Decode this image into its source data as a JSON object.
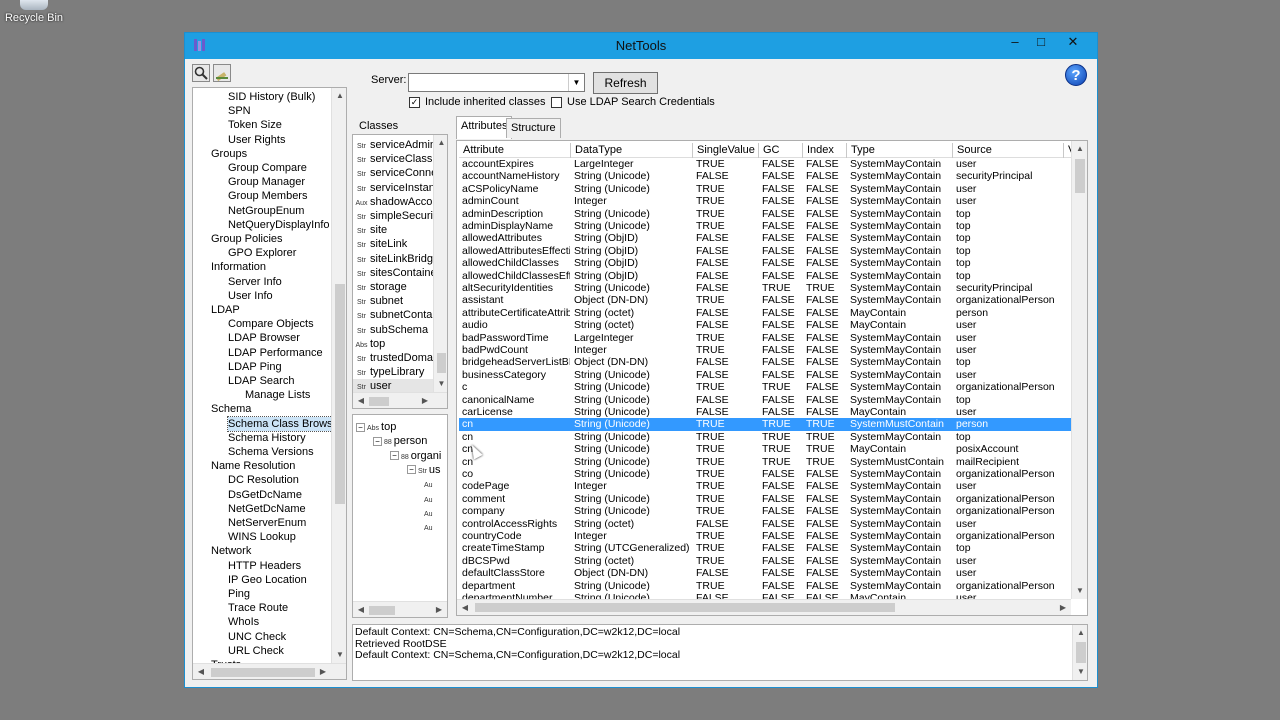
{
  "desktop": {
    "recycle_bin_label": "Recycle Bin"
  },
  "window": {
    "title": "NetTools",
    "min_glyph": "–",
    "max_glyph": "□",
    "close_glyph": "✕"
  },
  "toolbar": {
    "search_icon": "search-icon",
    "edit_icon": "edit-icon"
  },
  "nav_tree": {
    "items": [
      {
        "label": "SID History (Bulk)",
        "indent": 2
      },
      {
        "label": "SPN",
        "indent": 2
      },
      {
        "label": "Token Size",
        "indent": 2
      },
      {
        "label": "User Rights",
        "indent": 2
      },
      {
        "label": "Groups",
        "indent": 1
      },
      {
        "label": "Group Compare",
        "indent": 2
      },
      {
        "label": "Group Manager",
        "indent": 2
      },
      {
        "label": "Group Members",
        "indent": 2
      },
      {
        "label": "NetGroupEnum",
        "indent": 2
      },
      {
        "label": "NetQueryDisplayInfo",
        "indent": 2
      },
      {
        "label": "Group Policies",
        "indent": 1
      },
      {
        "label": "GPO Explorer",
        "indent": 2
      },
      {
        "label": "Information",
        "indent": 1
      },
      {
        "label": "Server Info",
        "indent": 2
      },
      {
        "label": "User Info",
        "indent": 2
      },
      {
        "label": "LDAP",
        "indent": 1
      },
      {
        "label": "Compare Objects",
        "indent": 2
      },
      {
        "label": "LDAP Browser",
        "indent": 2
      },
      {
        "label": "LDAP Performance",
        "indent": 2
      },
      {
        "label": "LDAP Ping",
        "indent": 2
      },
      {
        "label": "LDAP Search",
        "indent": 2
      },
      {
        "label": "Manage Lists",
        "indent": 3
      },
      {
        "label": "Schema",
        "indent": 1
      },
      {
        "label": "Schema Class Browser",
        "indent": 2,
        "selected": true
      },
      {
        "label": "Schema History",
        "indent": 2
      },
      {
        "label": "Schema Versions",
        "indent": 2
      },
      {
        "label": "Name Resolution",
        "indent": 1
      },
      {
        "label": "DC Resolution",
        "indent": 2
      },
      {
        "label": "DsGetDcName",
        "indent": 2
      },
      {
        "label": "NetGetDcName",
        "indent": 2
      },
      {
        "label": "NetServerEnum",
        "indent": 2
      },
      {
        "label": "WINS Lookup",
        "indent": 2
      },
      {
        "label": "Network",
        "indent": 1
      },
      {
        "label": "HTTP Headers",
        "indent": 2
      },
      {
        "label": "IP Geo Location",
        "indent": 2
      },
      {
        "label": "Ping",
        "indent": 2
      },
      {
        "label": "Trace Route",
        "indent": 2
      },
      {
        "label": "WhoIs",
        "indent": 2
      },
      {
        "label": "UNC Check",
        "indent": 2
      },
      {
        "label": "URL Check",
        "indent": 2
      },
      {
        "label": "Trusts",
        "indent": 1
      }
    ]
  },
  "server": {
    "label": "Server:",
    "value": "",
    "refresh_label": "Refresh"
  },
  "options": {
    "include_inherited": {
      "label": "Include inherited classes",
      "checked": true
    },
    "ldap_credentials": {
      "label": "Use LDAP Search Credentials",
      "checked": false
    }
  },
  "classes": {
    "label": "Classes",
    "items": [
      {
        "type": "Str",
        "name": "serviceAdminis"
      },
      {
        "type": "Str",
        "name": "serviceClass"
      },
      {
        "type": "Str",
        "name": "serviceConnec"
      },
      {
        "type": "Str",
        "name": "serviceInstanc"
      },
      {
        "type": "Aux",
        "name": "shadowAccou"
      },
      {
        "type": "Str",
        "name": "simpleSecurityI"
      },
      {
        "type": "Str",
        "name": "site"
      },
      {
        "type": "Str",
        "name": "siteLink"
      },
      {
        "type": "Str",
        "name": "siteLinkBridge"
      },
      {
        "type": "Str",
        "name": "sitesContainer"
      },
      {
        "type": "Str",
        "name": "storage"
      },
      {
        "type": "Str",
        "name": "subnet"
      },
      {
        "type": "Str",
        "name": "subnetContain"
      },
      {
        "type": "Str",
        "name": "subSchema"
      },
      {
        "type": "Abs",
        "name": "top"
      },
      {
        "type": "Str",
        "name": "trustedDomain"
      },
      {
        "type": "Str",
        "name": "typeLibrary"
      },
      {
        "type": "Str",
        "name": "user",
        "selected": true
      }
    ]
  },
  "structure_tree": {
    "items": [
      {
        "type": "Abs",
        "name": "top",
        "level": 0,
        "toggle": "−"
      },
      {
        "type": "88",
        "name": "person",
        "level": 1,
        "toggle": "−"
      },
      {
        "type": "88",
        "name": "organi",
        "level": 2,
        "toggle": "−"
      },
      {
        "type": "Str",
        "name": "us",
        "level": 3,
        "toggle": "−"
      },
      {
        "type": "Au",
        "name": "",
        "level": 4
      },
      {
        "type": "Au",
        "name": "",
        "level": 4
      },
      {
        "type": "Au",
        "name": "",
        "level": 4
      },
      {
        "type": "Au",
        "name": "",
        "level": 4
      }
    ]
  },
  "tabs": [
    {
      "label": "Attributes",
      "active": true
    },
    {
      "label": "Structure",
      "active": false
    }
  ],
  "attributes": {
    "columns": [
      "Attribute",
      "DataType",
      "SingleValue",
      "GC",
      "Index",
      "Type",
      "Source",
      "V"
    ],
    "rows": [
      [
        "accountExpires",
        "LargeInteger",
        "TRUE",
        "FALSE",
        "FALSE",
        "SystemMayContain",
        "user"
      ],
      [
        "accountNameHistory",
        "String (Unicode)",
        "FALSE",
        "FALSE",
        "FALSE",
        "SystemMayContain",
        "securityPrincipal"
      ],
      [
        "aCSPolicyName",
        "String (Unicode)",
        "TRUE",
        "FALSE",
        "FALSE",
        "SystemMayContain",
        "user"
      ],
      [
        "adminCount",
        "Integer",
        "TRUE",
        "FALSE",
        "FALSE",
        "SystemMayContain",
        "user"
      ],
      [
        "adminDescription",
        "String (Unicode)",
        "TRUE",
        "FALSE",
        "FALSE",
        "SystemMayContain",
        "top"
      ],
      [
        "adminDisplayName",
        "String (Unicode)",
        "TRUE",
        "FALSE",
        "FALSE",
        "SystemMayContain",
        "top"
      ],
      [
        "allowedAttributes",
        "String (ObjID)",
        "FALSE",
        "FALSE",
        "FALSE",
        "SystemMayContain",
        "top"
      ],
      [
        "allowedAttributesEffecti...",
        "String (ObjID)",
        "FALSE",
        "FALSE",
        "FALSE",
        "SystemMayContain",
        "top"
      ],
      [
        "allowedChildClasses",
        "String (ObjID)",
        "FALSE",
        "FALSE",
        "FALSE",
        "SystemMayContain",
        "top"
      ],
      [
        "allowedChildClassesEff...",
        "String (ObjID)",
        "FALSE",
        "FALSE",
        "FALSE",
        "SystemMayContain",
        "top"
      ],
      [
        "altSecurityIdentities",
        "String (Unicode)",
        "FALSE",
        "TRUE",
        "TRUE",
        "SystemMayContain",
        "securityPrincipal"
      ],
      [
        "assistant",
        "Object (DN-DN)",
        "TRUE",
        "FALSE",
        "FALSE",
        "SystemMayContain",
        "organizationalPerson"
      ],
      [
        "attributeCertificateAttrib...",
        "String (octet)",
        "FALSE",
        "FALSE",
        "FALSE",
        "MayContain",
        "person"
      ],
      [
        "audio",
        "String (octet)",
        "FALSE",
        "FALSE",
        "FALSE",
        "MayContain",
        "user"
      ],
      [
        "badPasswordTime",
        "LargeInteger",
        "TRUE",
        "FALSE",
        "FALSE",
        "SystemMayContain",
        "user"
      ],
      [
        "badPwdCount",
        "Integer",
        "TRUE",
        "FALSE",
        "FALSE",
        "SystemMayContain",
        "user"
      ],
      [
        "bridgeheadServerListBL",
        "Object (DN-DN)",
        "FALSE",
        "FALSE",
        "FALSE",
        "SystemMayContain",
        "top"
      ],
      [
        "businessCategory",
        "String (Unicode)",
        "FALSE",
        "FALSE",
        "FALSE",
        "SystemMayContain",
        "user"
      ],
      [
        "c",
        "String (Unicode)",
        "TRUE",
        "TRUE",
        "FALSE",
        "SystemMayContain",
        "organizationalPerson"
      ],
      [
        "canonicalName",
        "String (Unicode)",
        "FALSE",
        "FALSE",
        "FALSE",
        "SystemMayContain",
        "top"
      ],
      [
        "carLicense",
        "String (Unicode)",
        "FALSE",
        "FALSE",
        "FALSE",
        "MayContain",
        "user"
      ],
      [
        "cn",
        "String (Unicode)",
        "TRUE",
        "TRUE",
        "TRUE",
        "SystemMustContain",
        "person",
        true
      ],
      [
        "cn",
        "String (Unicode)",
        "TRUE",
        "TRUE",
        "TRUE",
        "SystemMayContain",
        "top"
      ],
      [
        "cn",
        "String (Unicode)",
        "TRUE",
        "TRUE",
        "TRUE",
        "MayContain",
        "posixAccount"
      ],
      [
        "cn",
        "String (Unicode)",
        "TRUE",
        "TRUE",
        "TRUE",
        "SystemMustContain",
        "mailRecipient"
      ],
      [
        "co",
        "String (Unicode)",
        "TRUE",
        "FALSE",
        "FALSE",
        "SystemMayContain",
        "organizationalPerson"
      ],
      [
        "codePage",
        "Integer",
        "TRUE",
        "FALSE",
        "FALSE",
        "SystemMayContain",
        "user"
      ],
      [
        "comment",
        "String (Unicode)",
        "TRUE",
        "FALSE",
        "FALSE",
        "SystemMayContain",
        "organizationalPerson"
      ],
      [
        "company",
        "String (Unicode)",
        "TRUE",
        "FALSE",
        "FALSE",
        "SystemMayContain",
        "organizationalPerson"
      ],
      [
        "controlAccessRights",
        "String (octet)",
        "FALSE",
        "FALSE",
        "FALSE",
        "SystemMayContain",
        "user"
      ],
      [
        "countryCode",
        "Integer",
        "TRUE",
        "FALSE",
        "FALSE",
        "SystemMayContain",
        "organizationalPerson"
      ],
      [
        "createTimeStamp",
        "String (UTCGeneralized)",
        "TRUE",
        "FALSE",
        "FALSE",
        "SystemMayContain",
        "top"
      ],
      [
        "dBCSPwd",
        "String (octet)",
        "TRUE",
        "FALSE",
        "FALSE",
        "SystemMayContain",
        "user"
      ],
      [
        "defaultClassStore",
        "Object (DN-DN)",
        "FALSE",
        "FALSE",
        "FALSE",
        "SystemMayContain",
        "user"
      ],
      [
        "department",
        "String (Unicode)",
        "TRUE",
        "FALSE",
        "FALSE",
        "SystemMayContain",
        "organizationalPerson"
      ],
      [
        "departmentNumber",
        "String (Unicode)",
        "FALSE",
        "FALSE",
        "FALSE",
        "MayContain",
        "user"
      ]
    ]
  },
  "log": {
    "lines": [
      "Default Context: CN=Schema,CN=Configuration,DC=w2k12,DC=local",
      "Retrieved RootDSE",
      "Default Context: CN=Schema,CN=Configuration,DC=w2k12,DC=local"
    ]
  },
  "colors": {
    "titlebar": "#1e9fe2",
    "selection": "#3399ff",
    "desktop": "#7d7d7d"
  }
}
